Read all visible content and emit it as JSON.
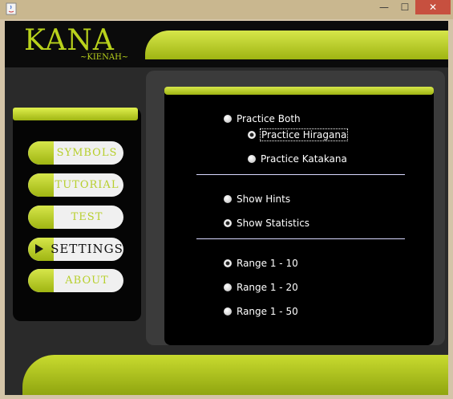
{
  "window": {
    "title": "",
    "minimize": "—",
    "maximize": "☐",
    "close": "✕"
  },
  "logo": {
    "main": "KANA",
    "sub": "~KIENAH~"
  },
  "nav": [
    {
      "label": "SYMBOLS",
      "active": false
    },
    {
      "label": "TUTORIAL",
      "active": false
    },
    {
      "label": "TEST",
      "active": false
    },
    {
      "label": "SETTINGS",
      "active": true
    },
    {
      "label": "ABOUT",
      "active": false
    }
  ],
  "settings": {
    "practice_both": "Practice Both",
    "practice_hiragana": "Practice Hiragana",
    "practice_katakana": "Practice Katakana",
    "show_hints": "Show Hints",
    "show_statistics": "Show Statistics",
    "range_10": "Range 1 - 10",
    "range_20": "Range 1 - 20",
    "range_50": "Range 1 - 50"
  },
  "colors": {
    "accent": "#b9d21c",
    "background": "#111111"
  }
}
